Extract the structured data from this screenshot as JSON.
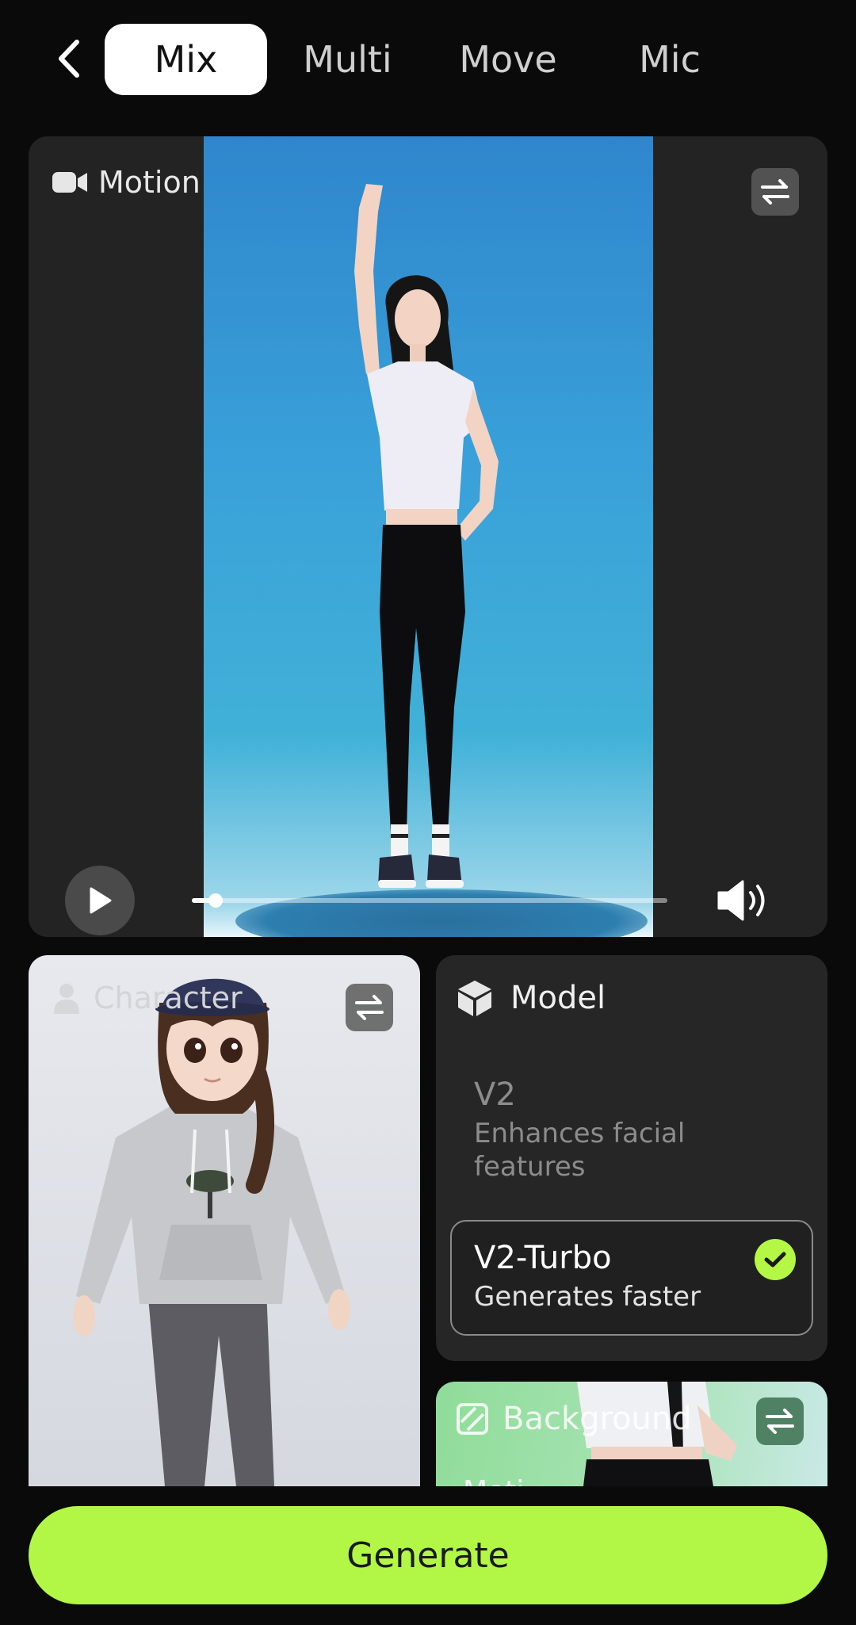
{
  "tabs": [
    {
      "label": "Mix",
      "active": true
    },
    {
      "label": "Multi",
      "active": false
    },
    {
      "label": "Move",
      "active": false
    },
    {
      "label": "Mic",
      "active": false
    }
  ],
  "motion": {
    "title": "Motion",
    "progress": 0.05
  },
  "character": {
    "title": "Character"
  },
  "model": {
    "title": "Model",
    "options": [
      {
        "name": "V2",
        "description": "Enhances facial features",
        "selected": false
      },
      {
        "name": "V2-Turbo",
        "description": "Generates faster",
        "selected": true
      }
    ]
  },
  "background": {
    "title": "Background",
    "subtitle": "Moti"
  },
  "generate_label": "Generate",
  "colors": {
    "accent": "#b2f746",
    "card": "#262626",
    "page": "#0a0a0a"
  },
  "icons": {
    "back": "chevron-left-icon",
    "motion": "video-camera-icon",
    "swap": "swap-arrows-icon",
    "play": "play-icon",
    "volume": "speaker-icon",
    "character": "person-icon",
    "model": "cube-icon",
    "check": "check-icon",
    "background": "hatch-icon"
  }
}
